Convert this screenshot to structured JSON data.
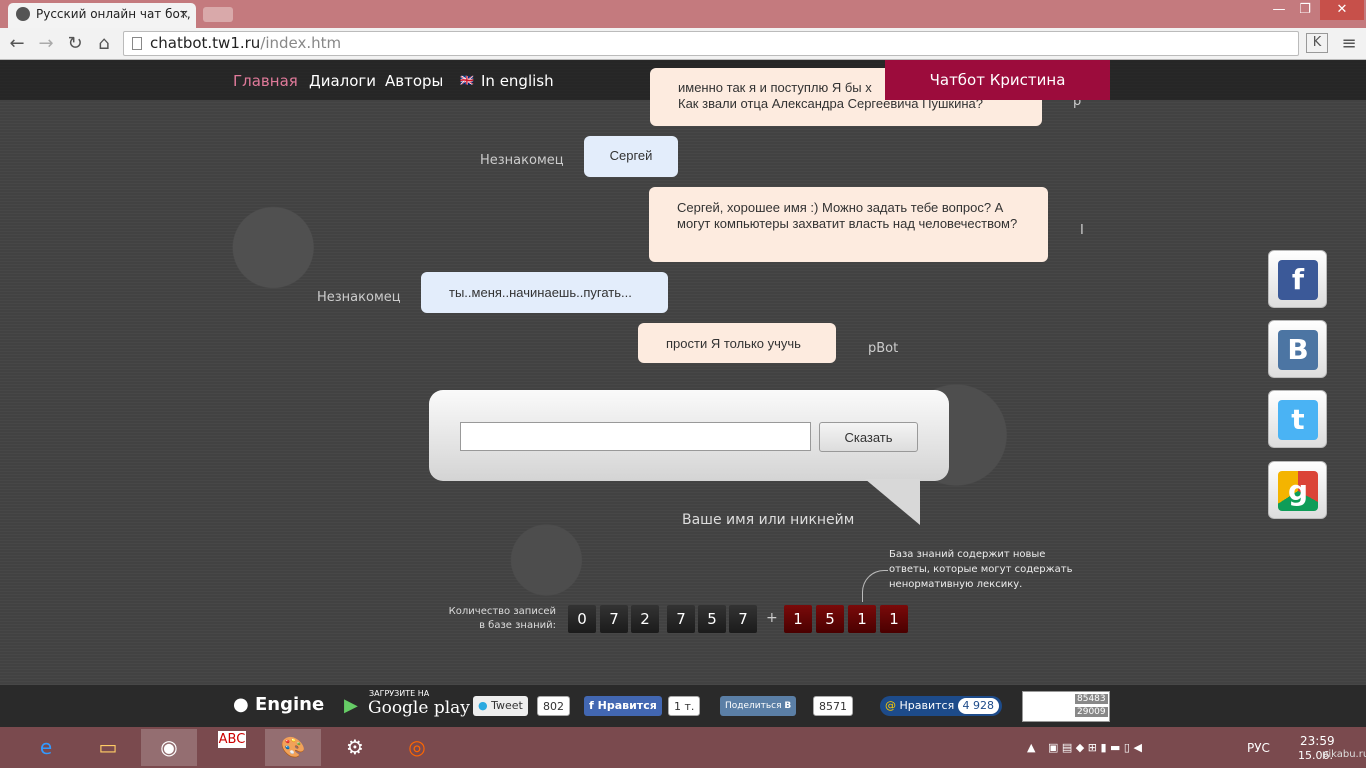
{
  "browser": {
    "tab_title": "Русский онлайн чат бот,",
    "tab_close": "×",
    "url_host": "chatbot.tw1.ru",
    "url_path": "/index.htm",
    "win_min": "—",
    "win_max": "❐",
    "win_close": "✕"
  },
  "nav": {
    "items": [
      "Главная",
      "Диалоги",
      "Авторы",
      "In english"
    ],
    "active_color": "#e07a9a",
    "title": "Чатбот Кристина",
    "title_color": "#9c0c3c"
  },
  "chat": [
    {
      "from": "bot",
      "text": "именно так я и поступлю Я бы х",
      "text2": "Как звали отца Александра Сергеевича Пушкина?",
      "speaker": "p"
    },
    {
      "from": "user",
      "text": "Сергей",
      "speaker": "Незнакомец"
    },
    {
      "from": "bot",
      "text": "Сергей, хорошее имя :) Можно задать тебе вопрос? А могут компьютеры захватит власть над человечеством?",
      "speaker": "I"
    },
    {
      "from": "user",
      "text": "ты..меня..начинаешь..пугать...",
      "speaker": "Незнакомец"
    },
    {
      "from": "bot",
      "text": "прости Я только учучь",
      "speaker": "pBot"
    }
  ],
  "input": {
    "value": "",
    "button": "Сказать",
    "caption": "Ваше имя или никнейм"
  },
  "counter": {
    "label": "Количество записей в базе знаний:",
    "digits": [
      "0",
      "7",
      "2",
      "7",
      "5",
      "7"
    ],
    "plus": "+",
    "extra_digits": [
      "1",
      "5",
      "1",
      "1"
    ],
    "note": "База знаний содержит новые ответы, которые могут содержать ненормативную лексику."
  },
  "social": [
    "f",
    "В",
    "t",
    "g"
  ],
  "footer": {
    "engine": "Engine",
    "gplay_small": "ЗАГРУЗИТЕ НА",
    "gplay": "Google play",
    "tweet": "Tweet",
    "tweet_count": "802",
    "fb": "Нравится",
    "fb_count": "1 т.",
    "vk": "Поделиться",
    "vk_count": "8571",
    "ok": "Нравится",
    "ok_count": "4 928",
    "stats1": "85483",
    "stats2": "29009"
  },
  "taskbar": {
    "lang": "РУС",
    "time": "23:59",
    "date": "15.06.",
    "watermark": "pikabu.ru"
  }
}
